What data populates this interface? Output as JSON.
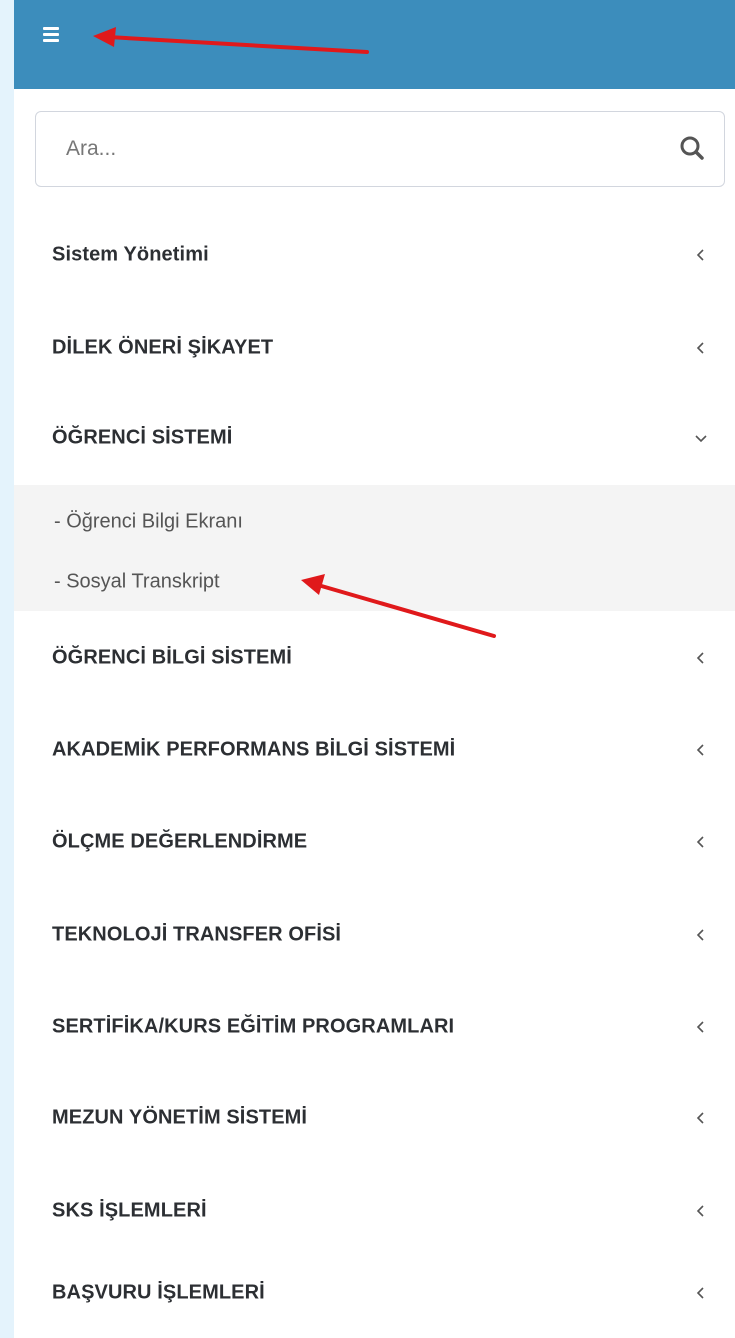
{
  "colors": {
    "page_bg": "#e4f3fc",
    "topbar": "#3c8dbc",
    "sidebar_bg": "#ffffff",
    "submenu_bg": "#f4f4f4",
    "menu_text": "#2c2f33",
    "annotation_arrow": "#e0191b"
  },
  "header": {
    "menu_toggle_icon": "hamburger-icon"
  },
  "search": {
    "placeholder": "Ara...",
    "value": "",
    "icon": "search-icon"
  },
  "menu": {
    "items": [
      {
        "label": "Sistem Yönetimi",
        "icon": "chevron-left-icon"
      },
      {
        "label": "DİLEK ÖNERİ ŞİKAYET",
        "icon": "chevron-left-icon"
      },
      {
        "label": "ÖĞRENCİ SİSTEMİ",
        "icon": "chevron-down-icon",
        "expanded": true
      },
      {
        "label": "ÖĞRENCİ BİLGİ SİSTEMİ",
        "icon": "chevron-left-icon"
      },
      {
        "label": "AKADEMİK PERFORMANS BİLGİ SİSTEMİ",
        "icon": "chevron-left-icon"
      },
      {
        "label": "ÖLÇME DEĞERLENDİRME",
        "icon": "chevron-left-icon"
      },
      {
        "label": "TEKNOLOJİ TRANSFER OFİSİ",
        "icon": "chevron-left-icon"
      },
      {
        "label": "SERTİFİKA/KURS EĞİTİM PROGRAMLARI",
        "icon": "chevron-left-icon"
      },
      {
        "label": "MEZUN YÖNETİM SİSTEMİ",
        "icon": "chevron-left-icon"
      },
      {
        "label": "SKS İŞLEMLERİ",
        "icon": "chevron-left-icon"
      },
      {
        "label": "BAŞVURU İŞLEMLERİ",
        "icon": "chevron-left-icon"
      }
    ],
    "submenu": [
      {
        "label": "- Öğrenci Bilgi Ekranı"
      },
      {
        "label": "- Sosyal Transkript"
      }
    ]
  }
}
